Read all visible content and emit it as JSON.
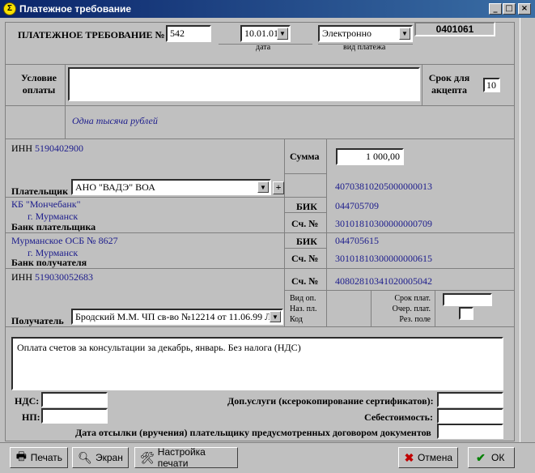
{
  "window": {
    "title": "Платежное требование",
    "icon": "sigma-icon",
    "controls": {
      "minimize": "_",
      "maximize": "□",
      "close": "×"
    }
  },
  "header": {
    "doc_title": "ПЛАТЕЖНОЕ ТРЕБОВАНИЕ №",
    "doc_number": "542",
    "date_value": "10.01.01",
    "date_caption": "дата",
    "payment_type_value": "Электронно",
    "payment_type_caption": "вид платежа",
    "form_code": "0401061"
  },
  "terms": {
    "label_line1": "Условие",
    "label_line2": "оплаты",
    "value": "",
    "acceptance_label_line1": "Срок для",
    "acceptance_label_line2": "акцепта",
    "acceptance_value": "10"
  },
  "amount_words": "Одна тысяча  рублей",
  "payer": {
    "inn_label": "ИНН",
    "inn_value": "5190402900",
    "label": "Плательщик",
    "name": "АНО \"ВАДЭ\" ВОА",
    "bank_name": "КБ \"Мончебанк\"",
    "bank_city": "г. Мурманск",
    "bank_label": "Банк плательщика"
  },
  "recipient": {
    "bank_name": "Мурманское ОСБ № 8627",
    "bank_city": "г. Мурманск",
    "bank_label": "Банк получателя",
    "inn_label": "ИНН",
    "inn_value": "519030052683",
    "label": "Получатель",
    "name": "Бродский М.М. ЧП св-во №12214 от 11.06.99 Л"
  },
  "right_column": {
    "sum_label": "Сумма",
    "sum_value": "1 000,00",
    "payer_account": "40703810205000000013",
    "bik_label": "БИК",
    "payer_bik": "044705709",
    "corr_label": "Сч. №",
    "payer_corr": "30101810300000000709",
    "recipient_bik": "044705615",
    "recipient_corr": "30101810300000000615",
    "recipient_account": "40802810341020005042",
    "op_type_label": "Вид оп.",
    "purpose_label": "Наз. пл.",
    "code_label": "Код",
    "due_label": "Срок плат.",
    "order_label": "Очер. плат.",
    "res_label": "Рез. поле",
    "due_value": "",
    "order_value": ""
  },
  "purpose_text": "Оплата счетов за консультации за декабрь, январь. Без налога (НДС)",
  "footer_fields": {
    "nds_label": "НДС:",
    "nds_value": "",
    "np_label": "НП:",
    "np_value": "",
    "extra_label": "Доп.услуги (ксерокопирование сертификатов):",
    "extra_value": "",
    "cost_label": "Себестоимость:",
    "cost_value": "",
    "send_date_label": "Дата отсылки (вручения) плательщику предусмотренных договором документов",
    "send_date_value": ""
  },
  "buttons": {
    "print": "Печать",
    "screen": "Экран",
    "print_setup": "Настройка печати",
    "cancel": "Отмена",
    "ok": "ОК"
  }
}
